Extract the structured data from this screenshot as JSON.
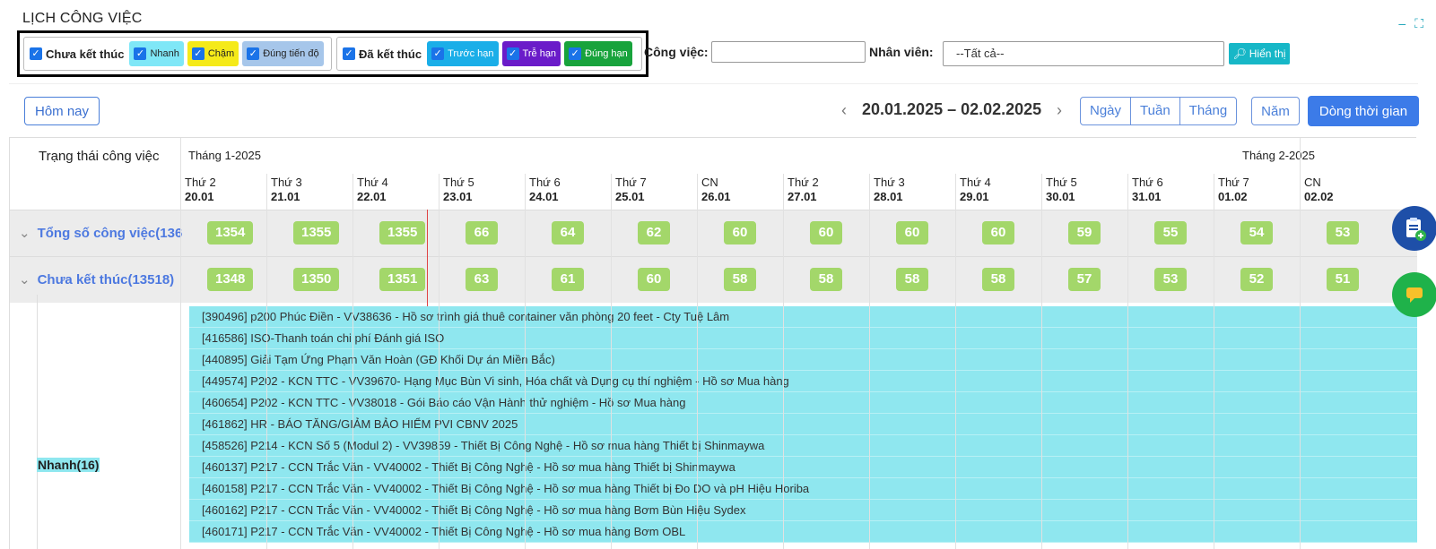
{
  "page": {
    "title": "LỊCH CÔNG VIỆC"
  },
  "window": {
    "minimize_glyph": "–",
    "maximize_glyph": "⛶"
  },
  "filters": {
    "group_open": {
      "main_label": "Chưa kết thúc",
      "items": [
        {
          "label": "Nhanh",
          "color": "#7fe7f7"
        },
        {
          "label": "Chậm",
          "color": "#f5ea19"
        },
        {
          "label": "Đúng tiến độ",
          "color": "#a6c6ea"
        }
      ]
    },
    "group_closed": {
      "main_label": "Đã kết thúc",
      "items": [
        {
          "label": "Trước hạn",
          "color": "#1aaee8"
        },
        {
          "label": "Trễ hạn",
          "color": "#6a1bc9"
        },
        {
          "label": "Đúng hạn",
          "color": "#18a33c"
        }
      ]
    },
    "task_label": "Công việc:",
    "task_value": "",
    "employee_label": "Nhân viên:",
    "employee_value": "--Tất cả--",
    "show_button": "Hiển thị"
  },
  "toolbar": {
    "today_button": "Hôm nay",
    "date_range": "20.01.2025 – 02.02.2025",
    "views": [
      "Ngày",
      "Tuần",
      "Tháng"
    ],
    "year_button": "Năm",
    "timeline_button": "Dòng thời gian"
  },
  "grid": {
    "header_title": "Trạng thái công việc",
    "months": [
      "Tháng 1-2025",
      "Tháng 2-2025"
    ],
    "days": [
      {
        "dow": "Thứ 2",
        "date": "20.01"
      },
      {
        "dow": "Thứ 3",
        "date": "21.01"
      },
      {
        "dow": "Thứ 4",
        "date": "22.01"
      },
      {
        "dow": "Thứ 5",
        "date": "23.01"
      },
      {
        "dow": "Thứ 6",
        "date": "24.01"
      },
      {
        "dow": "Thứ 7",
        "date": "25.01"
      },
      {
        "dow": "CN",
        "date": "26.01"
      },
      {
        "dow": "Thứ 2",
        "date": "27.01"
      },
      {
        "dow": "Thứ 3",
        "date": "28.01"
      },
      {
        "dow": "Thứ 4",
        "date": "29.01"
      },
      {
        "dow": "Thứ 5",
        "date": "30.01"
      },
      {
        "dow": "Thứ 6",
        "date": "31.01"
      },
      {
        "dow": "Thứ 7",
        "date": "01.02"
      },
      {
        "dow": "CN",
        "date": "02.02"
      }
    ],
    "rows": [
      {
        "label": "Tổng số công việc(136",
        "values": [
          "1354",
          "1355",
          "1355",
          "66",
          "64",
          "62",
          "60",
          "60",
          "60",
          "60",
          "59",
          "55",
          "54",
          "53"
        ]
      },
      {
        "label": "Chưa kết thúc(13518)",
        "values": [
          "1348",
          "1350",
          "1351",
          "63",
          "61",
          "60",
          "58",
          "58",
          "58",
          "58",
          "57",
          "53",
          "52",
          "51"
        ]
      }
    ],
    "group": {
      "label": "Nhanh(16)"
    },
    "tasks": [
      "[390496] p200 Phúc Điền - VV38636 - Hồ sơ trình giá thuê container văn phòng 20 feet - Cty Tuệ Lâm",
      "[416586] ISO-Thanh toán chi phí Đánh giá ISO",
      "[440895] Giải Tạm Ứng Phạm Văn Hoàn (GĐ Khối Dự án Miền Bắc)",
      "[449574] P202 - KCN TTC - VV39670- Hạng Mục Bùn Vi sinh, Hóa chất và Dụng cụ thí nghiệm - Hồ sơ Mua hàng",
      "[460654] P202 - KCN TTC - VV38018 - Gói Báo cáo Vận Hành thử nghiệm - Hồ sơ Mua hàng",
      "[461862] HR - BÁO TĂNG/GIẢM BẢO HIỂM PVI CBNV 2025",
      "[458526] P214 - KCN Số 5 (Modul 2) - VV39859 - Thiết Bị Công Nghệ - Hồ sơ mua hàng Thiết bị Shinmaywa",
      "[460137] P217 - CCN Trắc Văn - VV40002 - Thiết Bị Công Nghệ - Hồ sơ mua hàng Thiết bị Shinmaywa",
      "[460158] P217 - CCN Trắc Văn - VV40002 - Thiết Bị Công Nghệ - Hồ sơ mua hàng Thiết bị Đo DO và pH Hiệu Horiba",
      "[460162] P217 - CCN Trắc Văn - VV40002 - Thiết Bị Công Nghệ - Hồ sơ mua hàng Bơm Bùn Hiệu Sydex",
      "[460171] P217 - CCN Trắc Văn - VV40002 - Thiết Bị Công Nghệ - Hồ sơ mua hàng Bơm OBL"
    ]
  }
}
